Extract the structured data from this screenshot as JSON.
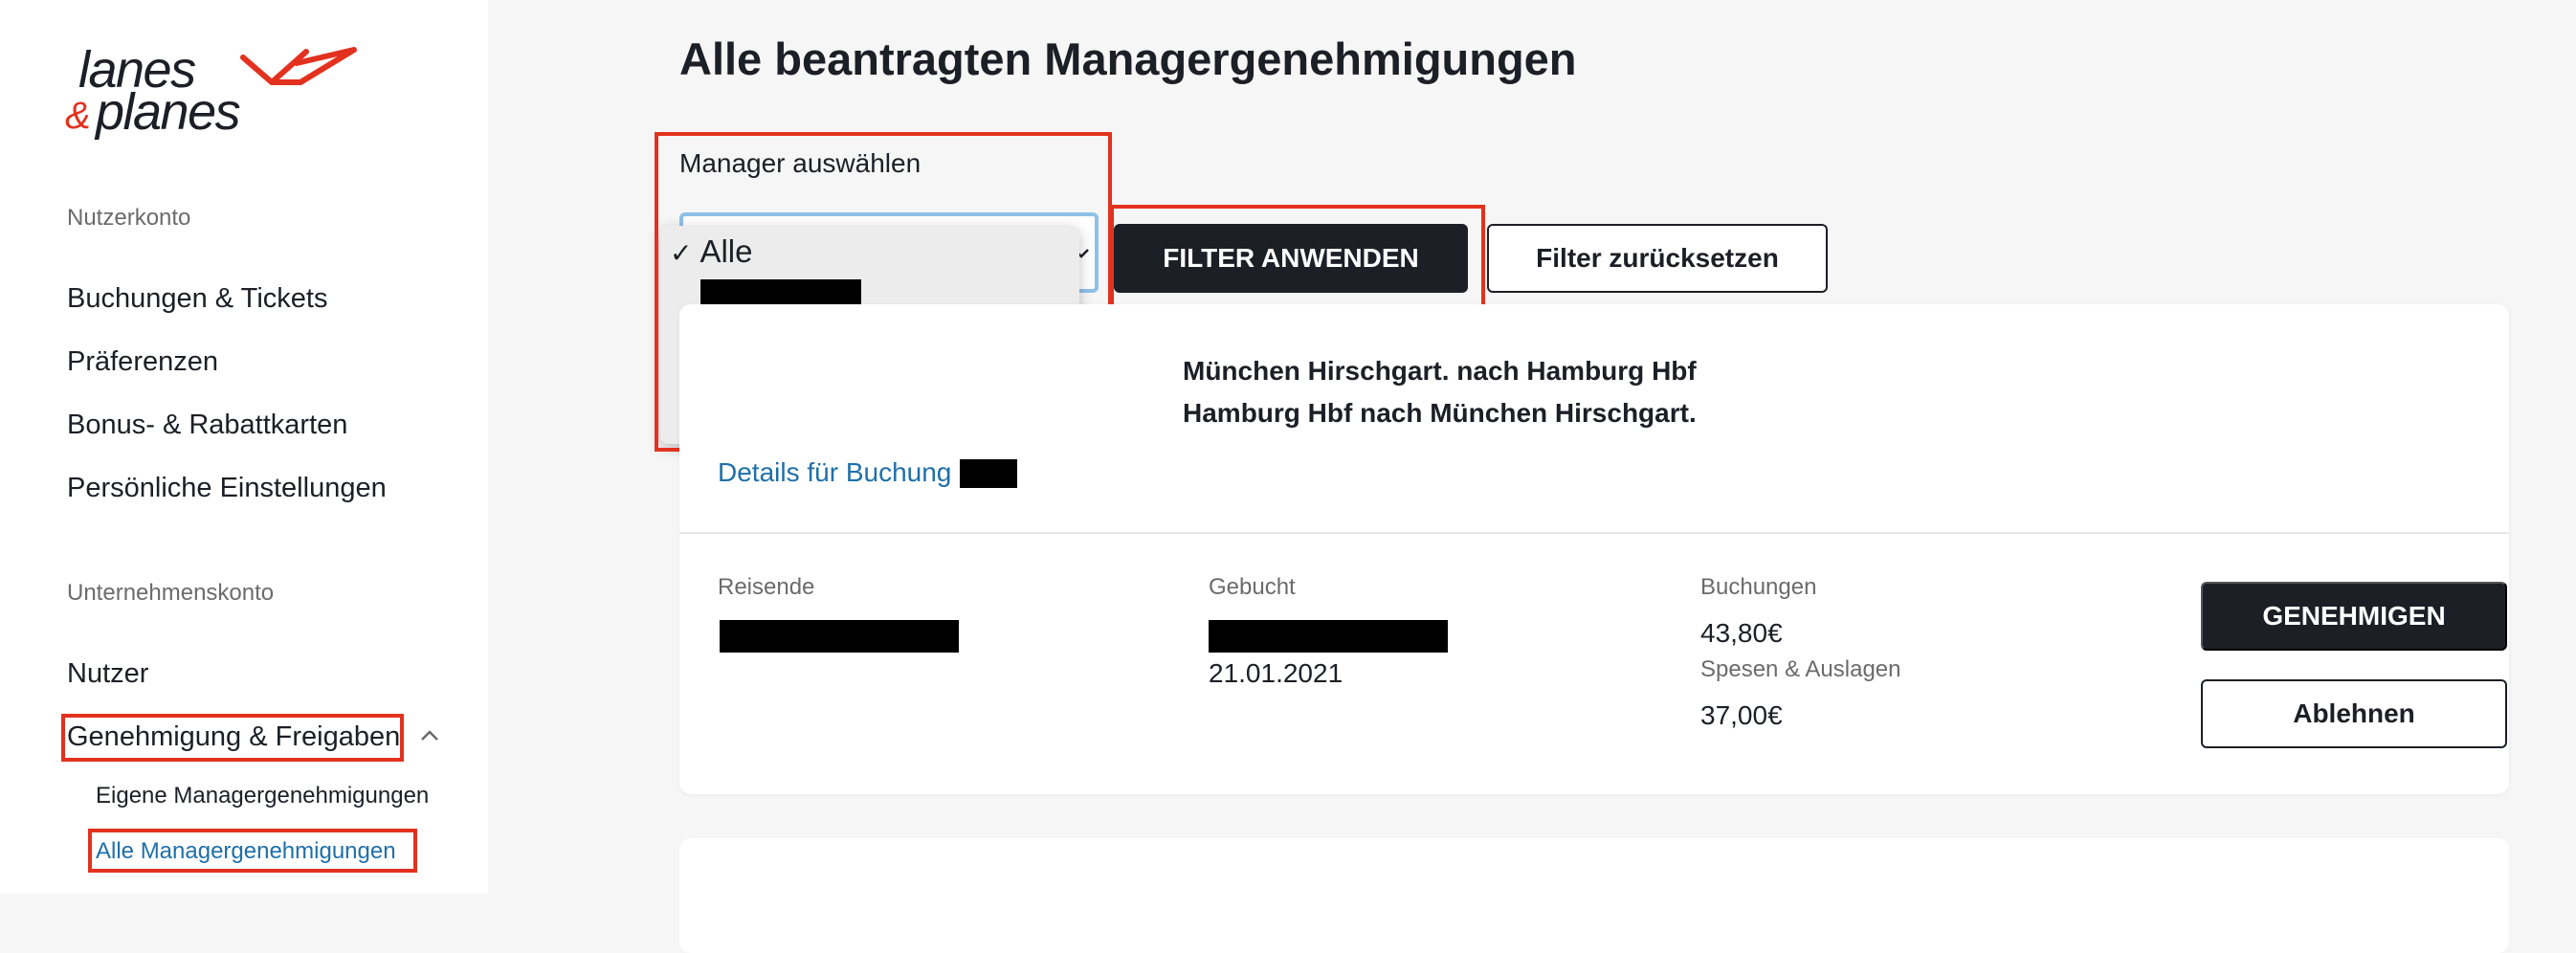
{
  "brand": {
    "line1": "lanes",
    "amp": "&",
    "line2": "planes",
    "accent": "#e2321f"
  },
  "sidebar": {
    "user_section": "Nutzerkonto",
    "user_items": [
      {
        "label": "Buchungen & Tickets"
      },
      {
        "label": "Präferenzen"
      },
      {
        "label": "Bonus- & Rabattkarten"
      },
      {
        "label": "Persönliche Einstellungen"
      }
    ],
    "company_section": "Unternehmenskonto",
    "company_items": [
      {
        "label": "Nutzer"
      },
      {
        "label": "Genehmigung & Freigaben"
      }
    ],
    "sub_items": [
      {
        "label": "Eigene Managergenehmigungen"
      },
      {
        "label": "Alle Managergenehmigungen"
      }
    ]
  },
  "main": {
    "title": "Alle beantragten Managergenehmigungen",
    "filter": {
      "label": "Manager auswählen",
      "selected_option": "Alle",
      "apply_label": "FILTER ANWENDEN",
      "reset_label": "Filter zurücksetzen"
    },
    "card": {
      "route_outbound": "München Hirschgart. nach Hamburg Hbf",
      "route_return": "Hamburg Hbf nach München Hirschgart.",
      "details_link": "Details für Buchung",
      "travelers_label": "Reisende",
      "booked_label": "Gebucht",
      "booked_date": "21.01.2021",
      "bookings_label": "Buchungen",
      "bookings_value": "43,80€",
      "expenses_label": "Spesen & Auslagen",
      "expenses_value": "37,00€",
      "approve_label": "GENEHMIGEN",
      "reject_label": "Ablehnen"
    }
  }
}
